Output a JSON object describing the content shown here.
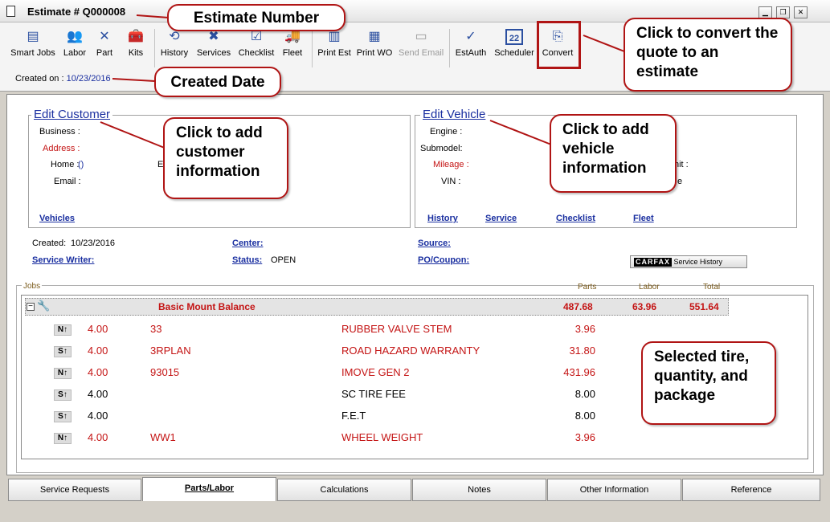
{
  "window": {
    "title": "Estimate # Q000008"
  },
  "toolbar": {
    "items": [
      {
        "label": "Smart Jobs",
        "icon": "smart-jobs-icon",
        "glyph": "▤"
      },
      {
        "label": "Labor",
        "icon": "labor-icon",
        "glyph": "👥"
      },
      {
        "label": "Part",
        "icon": "part-icon",
        "glyph": "✕"
      },
      {
        "label": "Kits",
        "icon": "kits-icon",
        "glyph": "🧰"
      },
      {
        "label": "History",
        "icon": "history-icon",
        "glyph": "⟲"
      },
      {
        "label": "Services",
        "icon": "services-icon",
        "glyph": "✖"
      },
      {
        "label": "Checklist",
        "icon": "checklist-icon",
        "glyph": "☑"
      },
      {
        "label": "Fleet",
        "icon": "fleet-icon",
        "glyph": "🚚"
      },
      {
        "label": "Print Est",
        "icon": "print-estimate-icon",
        "glyph": "▥"
      },
      {
        "label": "Print WO",
        "icon": "print-wo-icon",
        "glyph": "▦"
      },
      {
        "label": "Send Email",
        "icon": "send-email-icon",
        "glyph": "▭"
      },
      {
        "label": "EstAuth",
        "icon": "estauth-icon",
        "glyph": "✓"
      },
      {
        "label": "Scheduler",
        "icon": "scheduler-icon",
        "glyph": "22"
      },
      {
        "label": "Convert",
        "icon": "convert-icon",
        "glyph": "⎘"
      }
    ]
  },
  "created_on": {
    "label": "Created on :",
    "value": "10/23/2016"
  },
  "customer": {
    "title": "Edit Customer",
    "business_label": "Business :",
    "address_label": "Address :",
    "home_label": "Home :",
    "home_value": "()",
    "e_label": "E",
    "email_label": "Email :",
    "vehicles_link": "Vehicles"
  },
  "vehicle": {
    "title": "Edit Vehicle",
    "engine_label": "Engine :",
    "submodel_label": "Submodel:",
    "mileage_label": "Mileage :",
    "vin_label": "VIN :",
    "unit_label": "hit :",
    "e_label": "e",
    "links": {
      "history": "History",
      "service": "Service",
      "checklist": "Checklist",
      "fleet": "Fleet"
    }
  },
  "info": {
    "created_label": "Created:",
    "created_value": "10/23/2016",
    "service_writer_label": "Service Writer:",
    "center_label": "Center:",
    "status_label": "Status:",
    "status_value": "OPEN",
    "source_label": "Source:",
    "po_label": "PO/Coupon:",
    "carfax_logo": "CARFAX",
    "carfax_label": "Service History"
  },
  "jobs": {
    "label": "Jobs",
    "headers": {
      "parts": "Parts",
      "labor": "Labor",
      "total": "Total"
    },
    "job": {
      "name": "Basic Mount Balance",
      "parts": "487.68",
      "labor": "63.96",
      "total": "551.64"
    },
    "rows": [
      {
        "type": "N",
        "qty": "4.00",
        "code": "33",
        "desc": "RUBBER VALVE STEM",
        "price": "3.96",
        "red": true
      },
      {
        "type": "S",
        "qty": "4.00",
        "code": "3RPLAN",
        "desc": "ROAD HAZARD WARRANTY",
        "price": "31.80",
        "red": true
      },
      {
        "type": "N",
        "qty": "4.00",
        "code": "93015",
        "desc": "IMOVE GEN 2",
        "price": "431.96",
        "red": true
      },
      {
        "type": "S",
        "qty": "4.00",
        "code": "",
        "desc": "SC TIRE FEE",
        "price": "8.00",
        "red": false
      },
      {
        "type": "S",
        "qty": "4.00",
        "code": "",
        "desc": "F.E.T",
        "price": "8.00",
        "red": false
      },
      {
        "type": "N",
        "qty": "4.00",
        "code": "WW1",
        "desc": "WHEEL WEIGHT",
        "price": "3.96",
        "red": true
      }
    ]
  },
  "tabs": [
    {
      "label": "Service Requests",
      "active": false
    },
    {
      "label": "Parts/Labor",
      "active": true
    },
    {
      "label": "Calculations",
      "active": false
    },
    {
      "label": "Notes",
      "active": false
    },
    {
      "label": "Other Information",
      "active": false
    },
    {
      "label": "Reference",
      "active": false
    }
  ],
  "callouts": {
    "estimate_number": "Estimate Number",
    "created_date": "Created Date",
    "convert": "Click to convert the quote to an estimate",
    "customer": "Click to add customer information",
    "vehicle": "Click to add vehicle information",
    "selected": "Selected tire, quantity, and package"
  },
  "colors": {
    "accent_red": "#b01414",
    "link_blue": "#1a2fa0",
    "item_red": "#c41414"
  }
}
